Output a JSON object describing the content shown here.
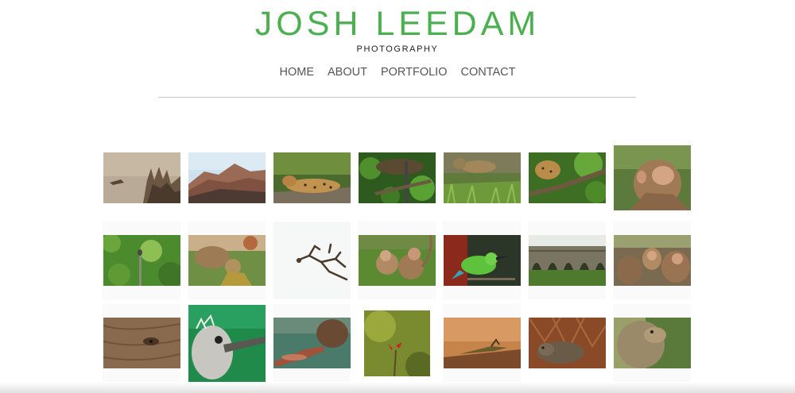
{
  "header": {
    "title": "JOSH LEEDAM",
    "subtitle": "PHOTOGRAPHY"
  },
  "nav": {
    "items": [
      "HOME",
      "ABOUT",
      "PORTFOLIO",
      "CONTACT"
    ]
  },
  "colors": {
    "brand": "#4caf50",
    "nav_text": "#555555",
    "divider": "#c9c9c9"
  },
  "gallery": {
    "photos": [
      {
        "subject": "driftwood-on-sand"
      },
      {
        "subject": "volcanic-hills"
      },
      {
        "subject": "leopard-on-rock"
      },
      {
        "subject": "leopard-in-tree-canopy"
      },
      {
        "subject": "leopard-in-grass"
      },
      {
        "subject": "leopard-on-branch"
      },
      {
        "subject": "monkey-looking-up"
      },
      {
        "subject": "bird-in-foliage"
      },
      {
        "subject": "monkey-eating"
      },
      {
        "subject": "bare-branch"
      },
      {
        "subject": "monkeys-on-grass"
      },
      {
        "subject": "green-bee-eater"
      },
      {
        "subject": "stone-bridge"
      },
      {
        "subject": "monkey-group"
      },
      {
        "subject": "elephant-eye"
      },
      {
        "subject": "bird-chick"
      },
      {
        "subject": "turtle-in-water"
      },
      {
        "subject": "red-flower"
      },
      {
        "subject": "lizard-on-soil"
      },
      {
        "subject": "monitor-lizard"
      },
      {
        "subject": "monkey-profile"
      }
    ]
  }
}
